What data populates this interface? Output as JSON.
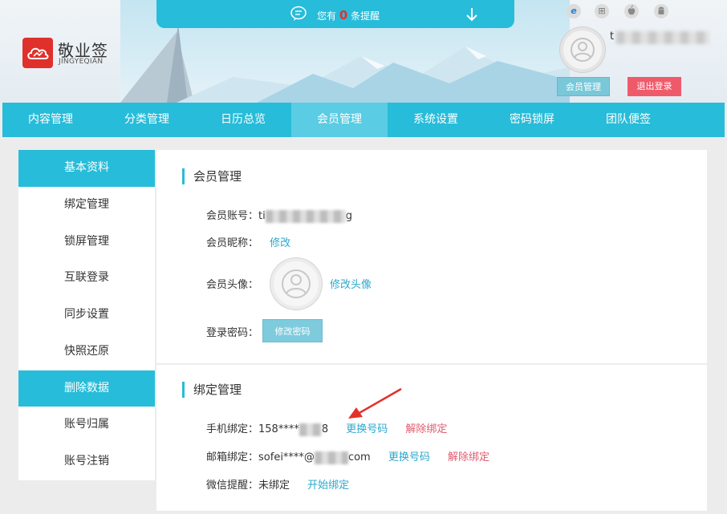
{
  "header": {
    "brand_cn": "敬业签",
    "brand_en": "JINGYEQIAN",
    "notice_prefix": "您有",
    "notice_count": "0",
    "notice_suffix": "条提醒",
    "username": "t",
    "member_btn": "会员管理",
    "logout_btn": "退出登录",
    "os_icons": [
      "ie-icon",
      "windows-icon",
      "apple-icon",
      "android-icon"
    ]
  },
  "nav": {
    "items": [
      "内容管理",
      "分类管理",
      "日历总览",
      "会员管理",
      "系统设置",
      "密码锁屏",
      "团队便签"
    ],
    "active_index": 3
  },
  "sidebar": {
    "items": [
      "基本资料",
      "绑定管理",
      "锁屏管理",
      "互联登录",
      "同步设置",
      "快照还原",
      "删除数据",
      "账号归属",
      "账号注销"
    ]
  },
  "member": {
    "title": "会员管理",
    "account_label": "会员账号：",
    "account_start": "ti",
    "account_end": "g",
    "nickname_label": "会员昵称：",
    "nickname_link": "修改",
    "avatar_label": "会员头像：",
    "avatar_link": "修改头像",
    "password_label": "登录密码：",
    "password_btn": "修改密码"
  },
  "binding": {
    "title": "绑定管理",
    "phone_label": "手机绑定：",
    "phone_start": "158****",
    "phone_end": "8",
    "phone_change": "更换号码",
    "phone_unbind": "解除绑定",
    "email_label": "邮箱绑定：",
    "email_start": "sofei****@",
    "email_end": "com",
    "email_change": "更换号码",
    "email_unbind": "解除绑定",
    "wechat_label": "微信提醒：",
    "wechat_status": "未绑定",
    "wechat_link": "开始绑定"
  },
  "colors": {
    "accent": "#27bcd9",
    "danger": "#ef5a6b",
    "link": "#2aa9cc",
    "link_red": "#e05a6e",
    "logo_red": "#e0302b"
  }
}
